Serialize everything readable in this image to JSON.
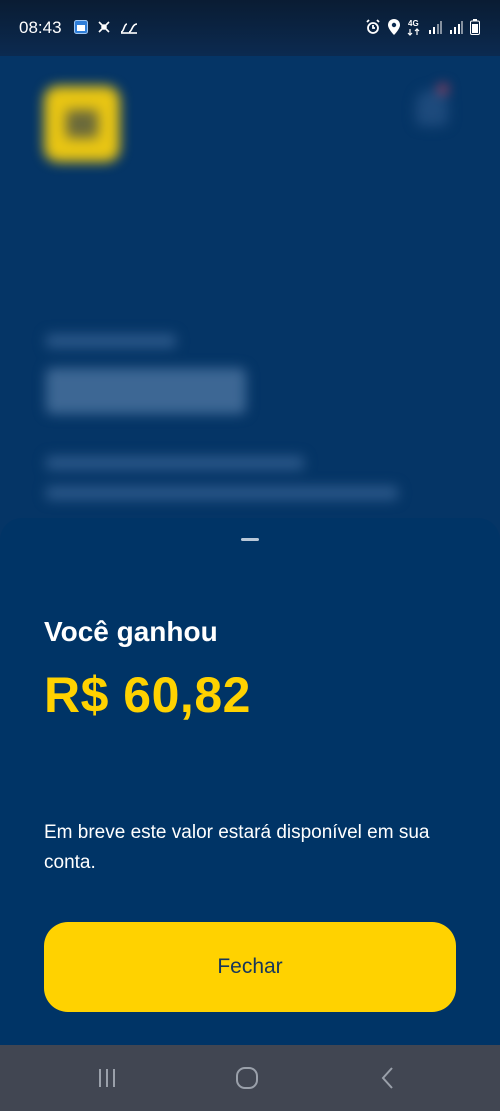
{
  "status_bar": {
    "time": "08:43",
    "left_icons": [
      "calendar-icon",
      "pinwheel-icon",
      "data-usage-icon"
    ],
    "right_icons": [
      "alarm-icon",
      "location-icon",
      "4g-icon",
      "signal-icon",
      "signal-icon-2",
      "battery-icon"
    ],
    "network": "4G"
  },
  "sheet": {
    "title": "Você ganhou",
    "amount": "R$ 60,82",
    "description": "Em breve este valor estará disponível em sua conta.",
    "close_button": "Fechar"
  },
  "nav_bar": {
    "items": [
      "recent-apps-icon",
      "home-icon",
      "back-icon"
    ]
  },
  "colors": {
    "background": "#04325f",
    "sheet": "#003466",
    "accent": "#ffd200",
    "button_text": "#16365b"
  }
}
